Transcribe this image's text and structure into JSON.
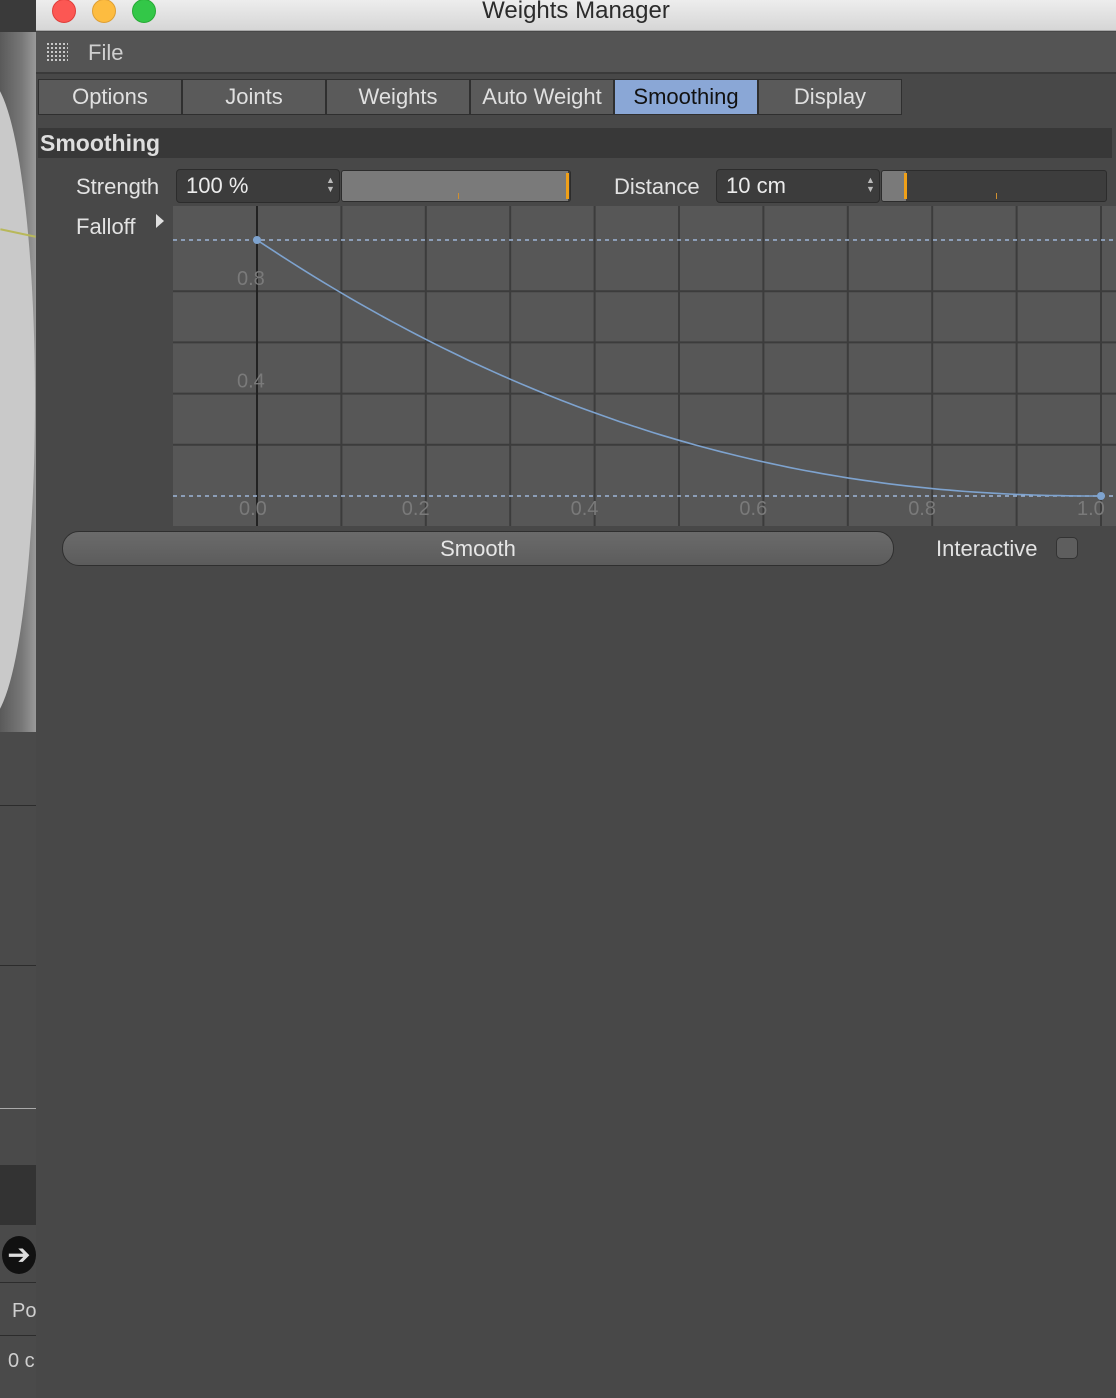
{
  "window": {
    "title": "Weights Manager"
  },
  "menu": {
    "file": "File"
  },
  "tabs": [
    "Options",
    "Joints",
    "Weights",
    "Auto Weight",
    "Smoothing",
    "Display"
  ],
  "active_tab": "Smoothing",
  "section": {
    "title": "Smoothing"
  },
  "strength": {
    "label": "Strength",
    "value": "100 %",
    "level": 1.0
  },
  "distance": {
    "label": "Distance",
    "value": "10 cm",
    "level": 0.1
  },
  "falloff": {
    "label": "Falloff",
    "y_ticks": [
      "0.8",
      "0.4"
    ],
    "x_ticks": [
      "0.0",
      "0.2",
      "0.4",
      "0.6",
      "0.8",
      "1.0"
    ],
    "curve": {
      "start": [
        0.0,
        1.0
      ],
      "end": [
        1.0,
        0.0
      ]
    }
  },
  "smooth_button": "Smooth",
  "interactive": {
    "label": "Interactive",
    "checked": false
  },
  "background_window": {
    "texts": [
      "Po",
      "0 c"
    ]
  },
  "colors": {
    "accent": "#8aa7d6",
    "knob": "#f0a018",
    "curve": "#7ea3cf"
  }
}
